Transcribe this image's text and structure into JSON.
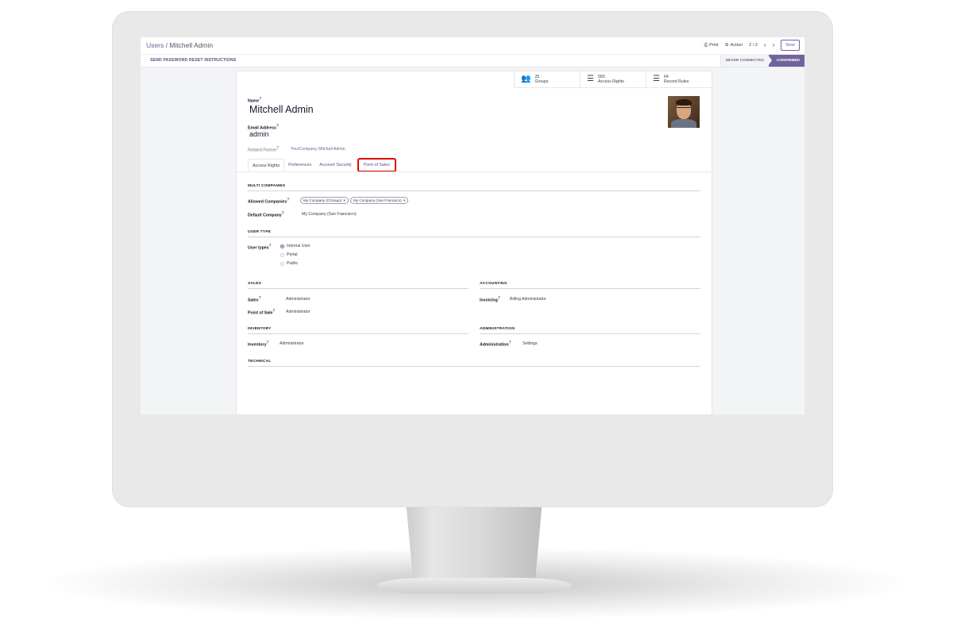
{
  "header": {
    "breadcrumb_parent": "Users",
    "breadcrumb_sep": " / ",
    "breadcrumb_current": "Mitchell Admin",
    "print_label": "Print",
    "action_label": "Action",
    "pager": "2 / 2",
    "new_label": "New"
  },
  "statusbar": {
    "reset_label": "SEND PASSWORD RESET INSTRUCTIONS",
    "stages": [
      "NEVER CONNECTED",
      "CONFIRMED"
    ],
    "active_stage": "CONFIRMED"
  },
  "stats": [
    {
      "count": "25",
      "label": "Groups",
      "icon": "users-icon"
    },
    {
      "count": "583",
      "label": "Access Rights",
      "icon": "list-icon"
    },
    {
      "count": "64",
      "label": "Record Rules",
      "icon": "list-icon"
    }
  ],
  "form": {
    "name_label": "Name",
    "name_value": "Mitchell Admin",
    "email_label": "Email Address",
    "email_value": "admin",
    "partner_label": "Related Partner",
    "partner_value": "YourCompany, Mitchell Admin"
  },
  "tabs": [
    "Access Rights",
    "Preferences",
    "Account Security",
    "Point of Sales"
  ],
  "access": {
    "multi_companies": "MULTI COMPANIES",
    "allowed_companies_label": "Allowed Companies",
    "allowed_companies": [
      "My Company (Chicago)",
      "My Company (San Francisco)"
    ],
    "tag_remove": "×",
    "default_company_label": "Default Company",
    "default_company_value": "My Company (San Francisco)",
    "user_type": "USER TYPE",
    "user_types_label": "User types",
    "user_types": [
      "Internal User",
      "Portal",
      "Public"
    ],
    "selected_user_type": "Internal User",
    "sales": "SALES",
    "sales_label": "Sales",
    "sales_value": "Administrator",
    "pos_label": "Point of Sale",
    "pos_value": "Administrator",
    "accounting": "ACCOUNTING",
    "invoicing_label": "Invoicing",
    "invoicing_value": "Billing Administrator",
    "inventory": "INVENTORY",
    "inventory_label": "Inventory",
    "inventory_value": "Administrator",
    "administration": "ADMINISTRATION",
    "administration_label": "Administration",
    "administration_value": "Settings",
    "technical": "TECHNICAL"
  },
  "colors": {
    "brand": "#71639e",
    "highlight": "#e10600"
  }
}
